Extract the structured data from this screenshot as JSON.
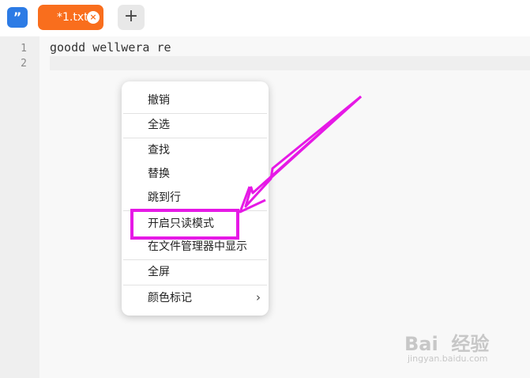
{
  "app": {
    "logo_glyph": "”",
    "tab": {
      "label": "*1.txt",
      "close_glyph": "×"
    },
    "add_tab_glyph": "+"
  },
  "editor": {
    "line_numbers": [
      "1",
      "2"
    ],
    "lines": [
      "goodd wellwera re",
      ""
    ]
  },
  "context_menu": {
    "items": [
      {
        "label": "撤销"
      },
      {
        "label": "全选"
      },
      {
        "label": "查找"
      },
      {
        "label": "替换"
      },
      {
        "label": "跳到行"
      },
      {
        "label": "开启只读模式",
        "highlighted": true
      },
      {
        "label": "在文件管理器中显示"
      },
      {
        "label": "全屏"
      },
      {
        "label": "颜色标记",
        "submenu_glyph": "›"
      }
    ]
  },
  "annotation": {
    "color": "#e619e6"
  },
  "watermark": {
    "brand": "Bai  经验",
    "url": "jingyan.baidu.com"
  },
  "colors": {
    "accent": "#f96e1d",
    "logo": "#2c7be5",
    "annotation": "#e619e6"
  }
}
